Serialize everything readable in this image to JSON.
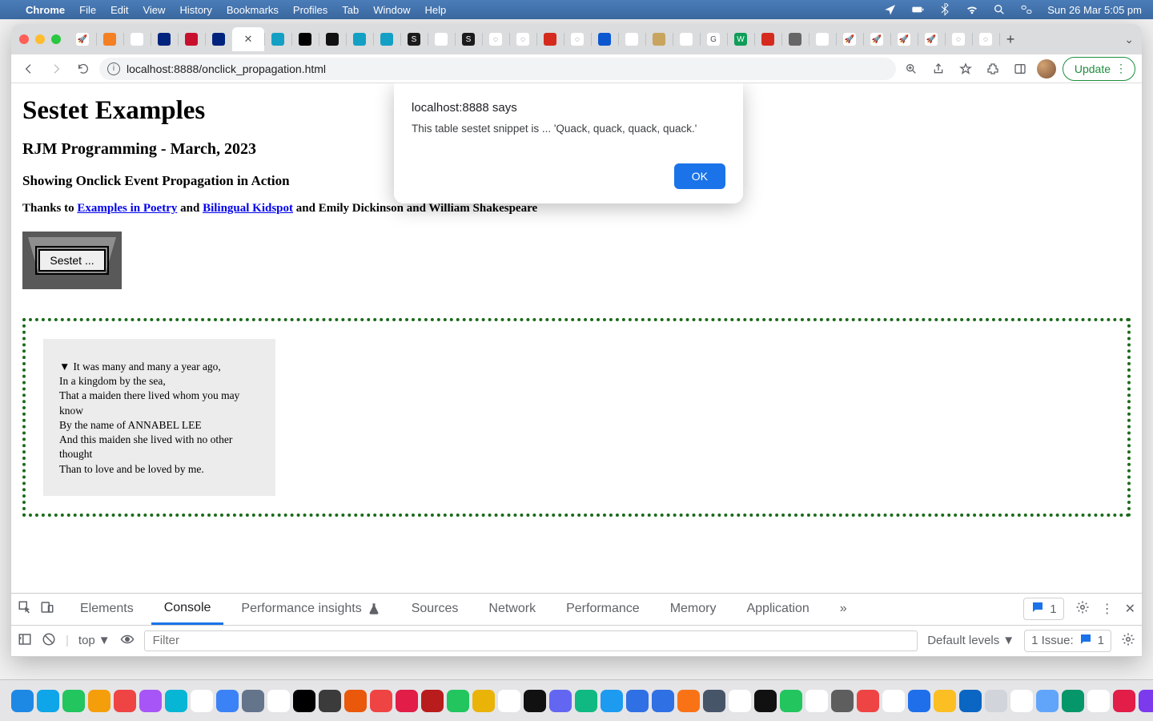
{
  "menubar": {
    "app": "Chrome",
    "items": [
      "File",
      "Edit",
      "View",
      "History",
      "Bookmarks",
      "Profiles",
      "Tab",
      "Window",
      "Help"
    ],
    "clock": "Sun 26 Mar  5:05 pm"
  },
  "toolbar": {
    "url": "localhost:8888/onclick_propagation.html",
    "update_label": "Update"
  },
  "alert": {
    "title": "localhost:8888 says",
    "message": "This table sestet snippet is  ... 'Quack, quack, quack, quack.'",
    "ok": "OK"
  },
  "page": {
    "h1": "Sestet Examples",
    "h2": "RJM Programming - March, 2023",
    "h3": "Showing Onclick Event Propagation in Action",
    "thanks_prefix": "Thanks to ",
    "link1": "Examples in Poetry",
    "mid1": " and ",
    "link2": "Bilingual Kidspot",
    "thanks_suffix": " and Emily Dickinson and William Shakespeare",
    "sestet_btn": "Sestet ...",
    "poem": [
      "It was many and many a year ago,",
      "In a kingdom by the sea,",
      "That a maiden there lived whom you may know",
      "By the name of ANNABEL LEE",
      "And this maiden she lived with no other thought",
      "Than to love and be loved by me."
    ]
  },
  "devtools": {
    "tabs": [
      "Elements",
      "Console",
      "Performance insights",
      "Sources",
      "Network",
      "Performance",
      "Memory",
      "Application"
    ],
    "active_tab": "Console",
    "badge_count": "1",
    "context": "top",
    "filter_placeholder": "Filter",
    "levels": "Default levels",
    "issue_label": "1 Issue:",
    "issue_count": "1"
  },
  "tabs": {
    "favicons": [
      {
        "bg": "#fff",
        "txt": "🚀"
      },
      {
        "bg": "#f48024",
        "txt": ""
      },
      {
        "bg": "#fff",
        "txt": ""
      },
      {
        "bg": "#00247d",
        "txt": ""
      },
      {
        "bg": "#c8102e",
        "txt": ""
      },
      {
        "bg": "#00247d",
        "txt": ""
      },
      {
        "bg": "#ffffff",
        "txt": "✕",
        "active": true
      },
      {
        "bg": "#14a0c4",
        "txt": ""
      },
      {
        "bg": "#000",
        "txt": ""
      },
      {
        "bg": "#111",
        "txt": ""
      },
      {
        "bg": "#14a0c4",
        "txt": ""
      },
      {
        "bg": "#14a0c4",
        "txt": ""
      },
      {
        "bg": "#1b1b1b",
        "txt": "S"
      },
      {
        "bg": "#fff",
        "txt": ""
      },
      {
        "bg": "#1b1b1b",
        "txt": "S"
      },
      {
        "bg": "#fff",
        "txt": "◌"
      },
      {
        "bg": "#fff",
        "txt": "◌"
      },
      {
        "bg": "#d52b1e",
        "txt": ""
      },
      {
        "bg": "#fff",
        "txt": "◌"
      },
      {
        "bg": "#0b57d0",
        "txt": ""
      },
      {
        "bg": "#fff",
        "txt": ""
      },
      {
        "bg": "#c8a45e",
        "txt": ""
      },
      {
        "bg": "#fff",
        "txt": ""
      },
      {
        "bg": "#fff",
        "txt": "G"
      },
      {
        "bg": "#0f9d58",
        "txt": "W"
      },
      {
        "bg": "#d52b1e",
        "txt": ""
      },
      {
        "bg": "#666",
        "txt": ""
      },
      {
        "bg": "#fff",
        "txt": ""
      },
      {
        "bg": "#fff",
        "txt": "🚀"
      },
      {
        "bg": "#fff",
        "txt": "🚀"
      },
      {
        "bg": "#fff",
        "txt": "🚀"
      },
      {
        "bg": "#fff",
        "txt": "🚀"
      },
      {
        "bg": "#fff",
        "txt": "◌"
      },
      {
        "bg": "#fff",
        "txt": "◌"
      }
    ]
  },
  "dock_colors": [
    "#1e88e5",
    "#0ea5e9",
    "#22c55e",
    "#f59e0b",
    "#ef4444",
    "#a855f7",
    "#06b6d4",
    "#fff",
    "#3b82f6",
    "#64748b",
    "#fff",
    "#000",
    "#3b3b3b",
    "#ea580c",
    "#ef4444",
    "#e11d48",
    "#b91c1c",
    "#22c55e",
    "#eab308",
    "#fff",
    "#111",
    "#6366f1",
    "#10b981",
    "#1d9bf0",
    "#2f70e4",
    "#2f70e4",
    "#f97316",
    "#475569",
    "#fff",
    "#111",
    "#22c55e",
    "#fff",
    "#5e5e5e",
    "#ef4444",
    "#fff",
    "#1f6feb",
    "#fbbf24",
    "#0a66c2",
    "#d1d5db",
    "#fff",
    "#60a5fa",
    "#059669",
    "#fff",
    "#e11d48",
    "#7c3aed",
    "#475569"
  ]
}
